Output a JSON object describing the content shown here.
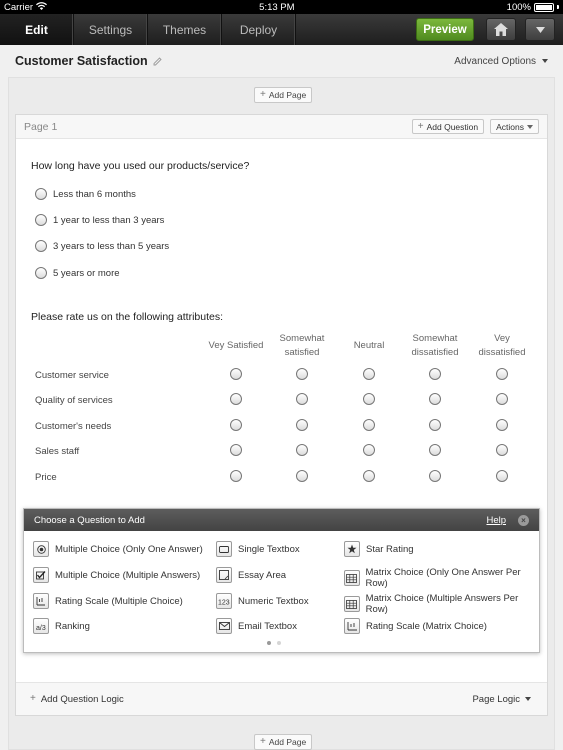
{
  "status_bar": {
    "carrier": "Carrier",
    "time": "5:13 PM",
    "battery": "100%"
  },
  "nav": {
    "tabs": [
      {
        "label": "Edit",
        "active": true
      },
      {
        "label": "Settings",
        "active": false
      },
      {
        "label": "Themes",
        "active": false
      },
      {
        "label": "Deploy",
        "active": false
      }
    ],
    "preview_label": "Preview"
  },
  "survey": {
    "title": "Customer Satisfaction",
    "advanced_options": "Advanced Options"
  },
  "add_page_label": "Add Page",
  "page": {
    "label": "Page 1",
    "add_question_label": "Add Question",
    "actions_label": "Actions",
    "question1": {
      "text": "How long have you used our products/service?",
      "options": [
        "Less than 6 months",
        "1 year to less than 3 years",
        "3 years to less than 5 years",
        "5 years or more"
      ]
    },
    "question2": {
      "text": "Please rate us on the following attributes:",
      "columns": [
        [
          "Vey Satisfied"
        ],
        [
          "Somewhat",
          "satisfied"
        ],
        [
          "Neutral"
        ],
        [
          "Somewhat",
          "dissatisfied"
        ],
        [
          "Vey",
          "dissatisfied"
        ]
      ],
      "rows": [
        "Customer service",
        "Quality of services",
        "Customer's needs",
        "Sales staff",
        "Price"
      ]
    },
    "footer": {
      "add_logic": "Add Question Logic",
      "page_logic": "Page Logic"
    }
  },
  "popup": {
    "title": "Choose a Question to Add",
    "help": "Help",
    "columns": [
      [
        {
          "label": "Multiple Choice (Only One Answer)",
          "icon": "radio-icon"
        },
        {
          "label": "Multiple Choice (Multiple Answers)",
          "icon": "checkbox-icon"
        },
        {
          "label": "Rating Scale (Multiple Choice)",
          "icon": "rating-scale-icon"
        },
        {
          "label": "Ranking",
          "icon": "ranking-icon"
        }
      ],
      [
        {
          "label": "Single Textbox",
          "icon": "textbox-icon"
        },
        {
          "label": "Essay Area",
          "icon": "essay-icon"
        },
        {
          "label": "Numeric Textbox",
          "icon": "numeric-icon"
        },
        {
          "label": "Email Textbox",
          "icon": "email-icon"
        }
      ],
      [
        {
          "label": "Star Rating",
          "icon": "star-icon"
        },
        {
          "label": "Matrix Choice (Only One Answer Per Row)",
          "icon": "matrix-icon"
        },
        {
          "label": "Matrix Choice (Multiple Answers Per Row)",
          "icon": "matrix-multi-icon"
        },
        {
          "label": "Rating Scale (Matrix Choice)",
          "icon": "matrix-rating-icon"
        }
      ]
    ]
  },
  "colors": {
    "preview": "#5f9e2a",
    "nav_bg": "#2b2b2b"
  }
}
